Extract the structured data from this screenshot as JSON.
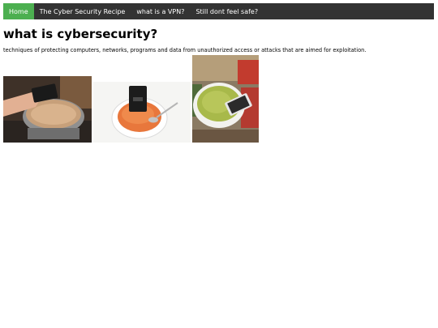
{
  "nav": {
    "items": [
      {
        "label": "Home",
        "active": true
      },
      {
        "label": "The Cyber Security Recipe",
        "active": false
      },
      {
        "label": "what is a VPN?",
        "active": false
      },
      {
        "label": "Still dont feel safe?",
        "active": false
      }
    ]
  },
  "main": {
    "title": "what is cybersecurity?",
    "description": "techniques of protecting computers, networks, programs and data from unauthorized access or attacks that are aimed for exploitation."
  },
  "colors": {
    "navbar_bg": "#333333",
    "nav_active_bg": "#4CAF50",
    "nav_text": "#ffffff"
  },
  "images": [
    {
      "depicts": "hand dipping phone into pot of soup on stove"
    },
    {
      "depicts": "phone in bowl of tomato soup with spoon"
    },
    {
      "depicts": "phone in bowl of guacamole"
    }
  ]
}
